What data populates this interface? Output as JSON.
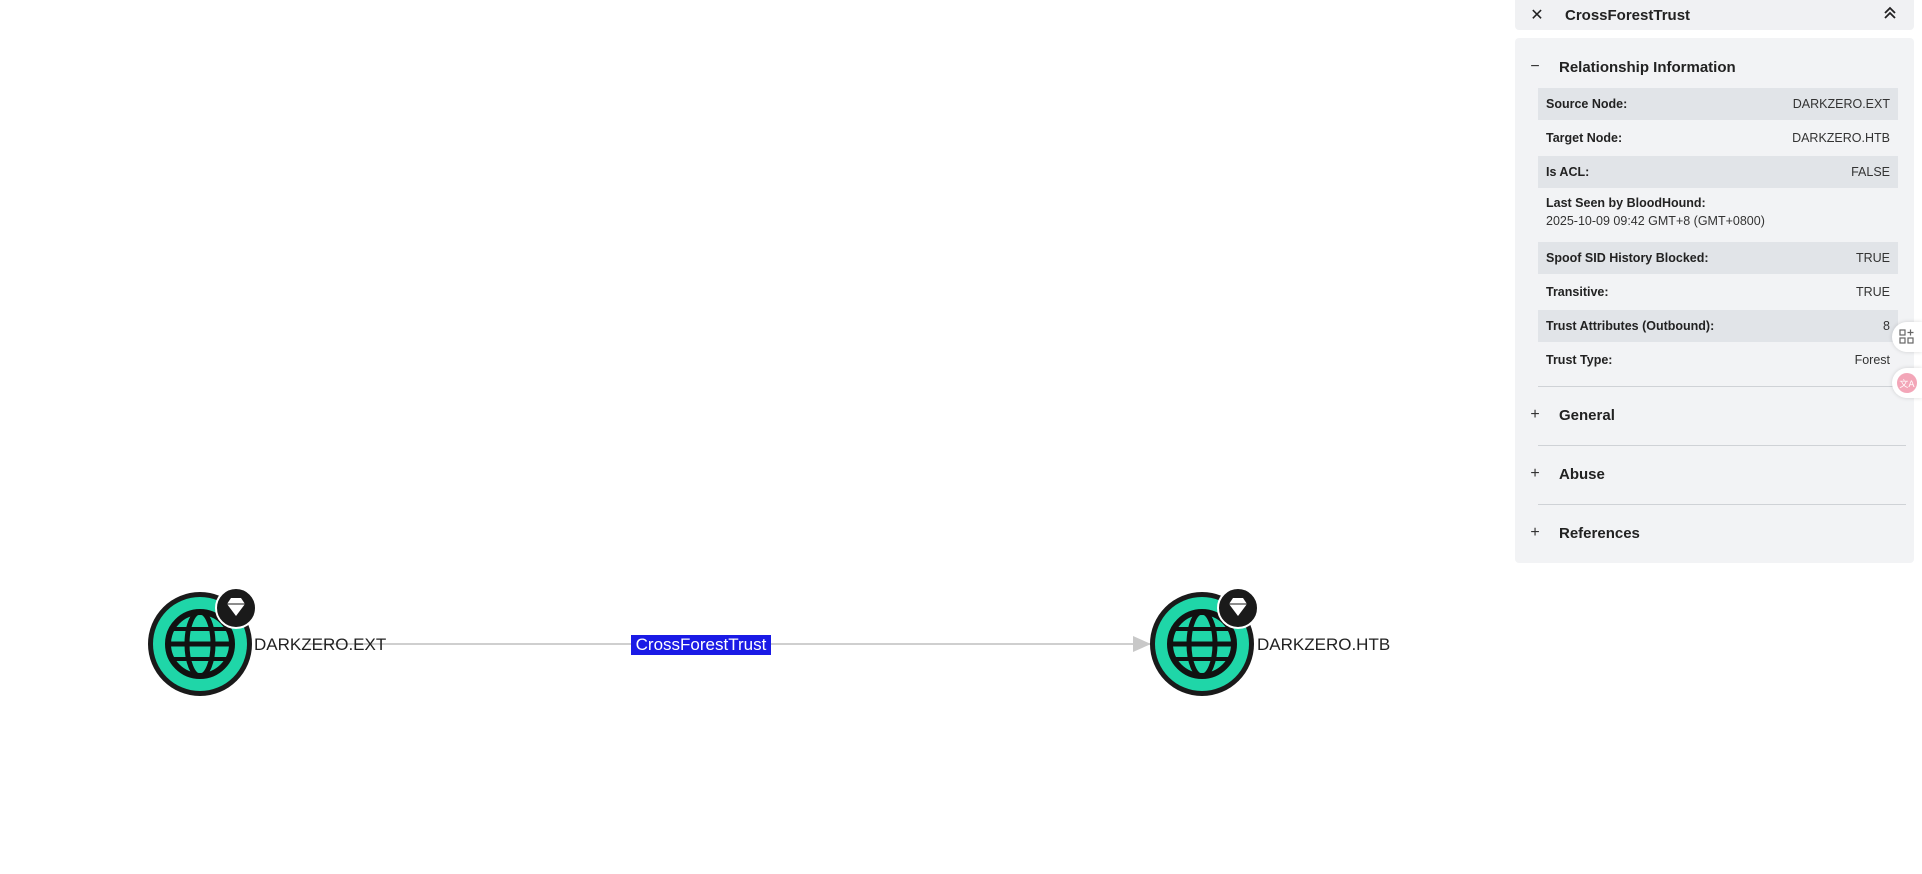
{
  "graph": {
    "source_node": "DARKZERO.EXT",
    "target_node": "DARKZERO.HTB",
    "edge_label": "CrossForestTrust",
    "node_color": "#1fd6a8",
    "edge_highlight": "#1a1ae6"
  },
  "panel": {
    "title": "CrossForestTrust",
    "sections": {
      "relationship": {
        "label": "Relationship Information",
        "expanded_sign": "−",
        "rows": [
          {
            "key": "Source Node:",
            "value": "DARKZERO.EXT"
          },
          {
            "key": "Target Node:",
            "value": "DARKZERO.HTB"
          },
          {
            "key": "Is ACL:",
            "value": "FALSE"
          },
          {
            "key": "Last Seen by BloodHound:",
            "value": "2025-10-09 09:42 GMT+8 (GMT+0800)"
          },
          {
            "key": "Spoof SID History Blocked:",
            "value": "TRUE"
          },
          {
            "key": "Transitive:",
            "value": "TRUE"
          },
          {
            "key": "Trust Attributes (Outbound):",
            "value": "8"
          },
          {
            "key": "Trust Type:",
            "value": "Forest"
          }
        ]
      },
      "general": {
        "label": "General",
        "sign": "+"
      },
      "abuse": {
        "label": "Abuse",
        "sign": "+"
      },
      "references": {
        "label": "References",
        "sign": "+"
      }
    }
  },
  "icons": {
    "close": "close-icon",
    "collapse": "double-chevron-up-icon",
    "node": "globe-icon",
    "badge": "gem-icon",
    "side_1": "grid-add-icon",
    "side_2": "translate-icon"
  }
}
